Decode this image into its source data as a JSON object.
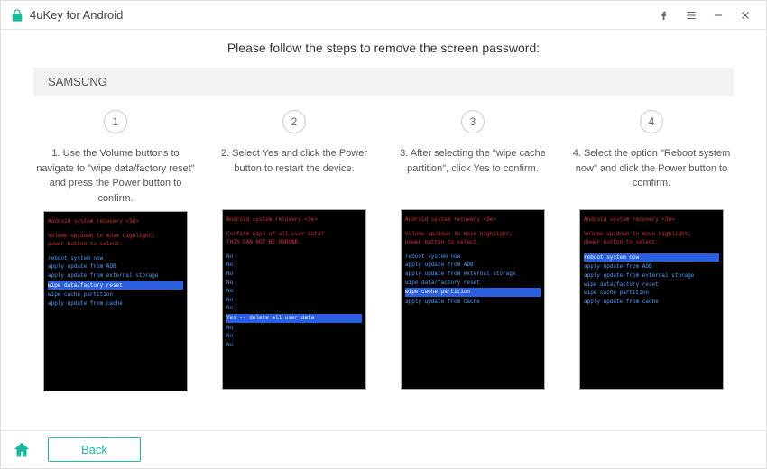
{
  "app": {
    "title": "4uKey for Android"
  },
  "page": {
    "heading": "Please follow the steps to remove the screen password:",
    "brand": "SAMSUNG"
  },
  "steps": [
    {
      "num": "1",
      "text": "1. Use the Volume buttons to navigate to \"wipe data/factory reset\" and press the Power button to confirm.",
      "screen": {
        "header": "Android system recovery <3e>",
        "sub1": "Volume up/down to move highlight;",
        "sub2": "power button to select.",
        "items": [
          {
            "t": "reboot system now",
            "hl": false
          },
          {
            "t": "apply update from ADB",
            "hl": false
          },
          {
            "t": "apply update from external storage",
            "hl": false
          },
          {
            "t": "wipe data/factory reset",
            "hl": true
          },
          {
            "t": "wipe cache partition",
            "hl": false
          },
          {
            "t": "apply update from cache",
            "hl": false
          }
        ]
      }
    },
    {
      "num": "2",
      "text": "2. Select Yes and click the Power button to restart the device.",
      "screen": {
        "header": "Android system recovery <3e>",
        "sub1": "Confirm wipe of all user data?",
        "sub2": "THIS CAN NOT BE UNDONE.",
        "items": [
          {
            "t": "No",
            "hl": false
          },
          {
            "t": "No",
            "hl": false
          },
          {
            "t": "No",
            "hl": false
          },
          {
            "t": "No",
            "hl": false
          },
          {
            "t": "No",
            "hl": false
          },
          {
            "t": "No",
            "hl": false
          },
          {
            "t": "No",
            "hl": false
          },
          {
            "t": "Yes -- delete all user data",
            "hl": true
          },
          {
            "t": "No",
            "hl": false
          },
          {
            "t": "No",
            "hl": false
          },
          {
            "t": "No",
            "hl": false
          }
        ]
      }
    },
    {
      "num": "3",
      "text": "3. After selecting the \"wipe cache partition\", click Yes to confirm.",
      "screen": {
        "header": "Android system recovery <3e>",
        "sub1": "Volume up/down to move highlight;",
        "sub2": "power button to select.",
        "items": [
          {
            "t": "reboot system now",
            "hl": false
          },
          {
            "t": "apply update from ADB",
            "hl": false
          },
          {
            "t": "apply update from external storage",
            "hl": false
          },
          {
            "t": "wipe data/factory reset",
            "hl": false
          },
          {
            "t": "wipe cache partition",
            "hl": true
          },
          {
            "t": "apply update from cache",
            "hl": false
          }
        ]
      }
    },
    {
      "num": "4",
      "text": "4. Select the option \"Reboot system now\" and click the Power button to comfirm.",
      "screen": {
        "header": "Android system recovery <3e>",
        "sub1": "Volume up/down to move highlight;",
        "sub2": "power button to select.",
        "items": [
          {
            "t": "reboot system now",
            "hl": true
          },
          {
            "t": "apply update from ADB",
            "hl": false
          },
          {
            "t": "apply update from external storage",
            "hl": false
          },
          {
            "t": "wipe data/factory reset",
            "hl": false
          },
          {
            "t": "wipe cache partition",
            "hl": false
          },
          {
            "t": "apply update from cache",
            "hl": false
          }
        ]
      }
    }
  ],
  "footer": {
    "back": "Back"
  }
}
